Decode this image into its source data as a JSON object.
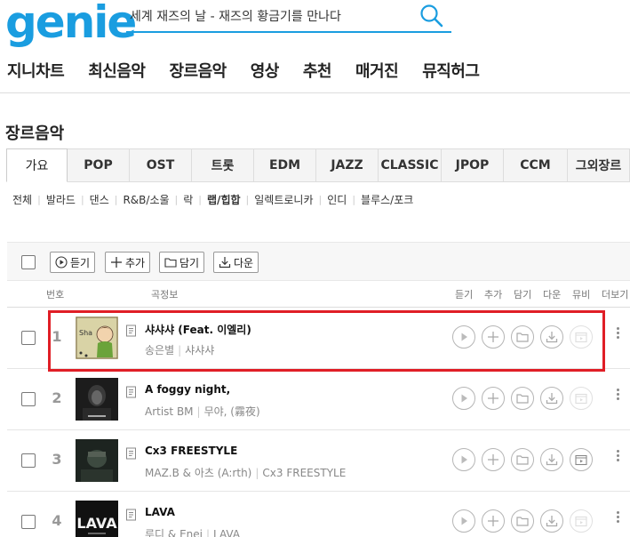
{
  "header": {
    "logo": "genie",
    "search_value": "세계 재즈의 날 - 재즈의 황금기를 만나다"
  },
  "gnb": [
    "지니차트",
    "최신음악",
    "장르음악",
    "영상",
    "추천",
    "매거진",
    "뮤직허그"
  ],
  "section_title": "장르음악",
  "genre_tabs": [
    {
      "label": "가요",
      "active": true
    },
    {
      "label": "POP"
    },
    {
      "label": "OST"
    },
    {
      "label": "트롯"
    },
    {
      "label": "EDM"
    },
    {
      "label": "JAZZ"
    },
    {
      "label": "CLASSIC"
    },
    {
      "label": "JPOP"
    },
    {
      "label": "CCM"
    },
    {
      "label": "그외장르"
    }
  ],
  "subgenres": [
    "전체",
    "발라드",
    "댄스",
    "R&B/소울",
    "락",
    "랩/힙합",
    "일렉트로니카",
    "인디",
    "블루스/포크"
  ],
  "active_subgenre": "랩/힙합",
  "toolbar": {
    "listen": "듣기",
    "add": "추가",
    "save": "담기",
    "download": "다운"
  },
  "columns": {
    "number": "번호",
    "info": "곡정보",
    "listen": "듣기",
    "add": "추가",
    "save": "담기",
    "download": "다운",
    "mv": "뮤비",
    "more": "더보기"
  },
  "songs": [
    {
      "rank": "1",
      "title": "샤샤샤 (Feat. 이엘리)",
      "artist": "송은별",
      "album": "샤샤샤",
      "cover_text": "Sha",
      "cover_color": "#d9d3a6",
      "mv": false
    },
    {
      "rank": "2",
      "title": "A foggy night,",
      "artist": "Artist BM",
      "album": "무야, (霧夜)",
      "cover_color": "#1c1c1c",
      "mv": false
    },
    {
      "rank": "3",
      "title": "Cx3 FREESTYLE",
      "artist": "MAZ.B & 아츠 (A:rth)",
      "album": "Cx3 FREESTYLE",
      "cover_color": "#1d2420",
      "mv": true
    },
    {
      "rank": "4",
      "title": "LAVA",
      "artist": "루디 & Enei",
      "album": "LAVA",
      "cover_text": "LAVA",
      "cover_color": "#111111",
      "mv": false
    }
  ],
  "colors": {
    "brand": "#1a9de0",
    "highlight": "#e01e26"
  }
}
